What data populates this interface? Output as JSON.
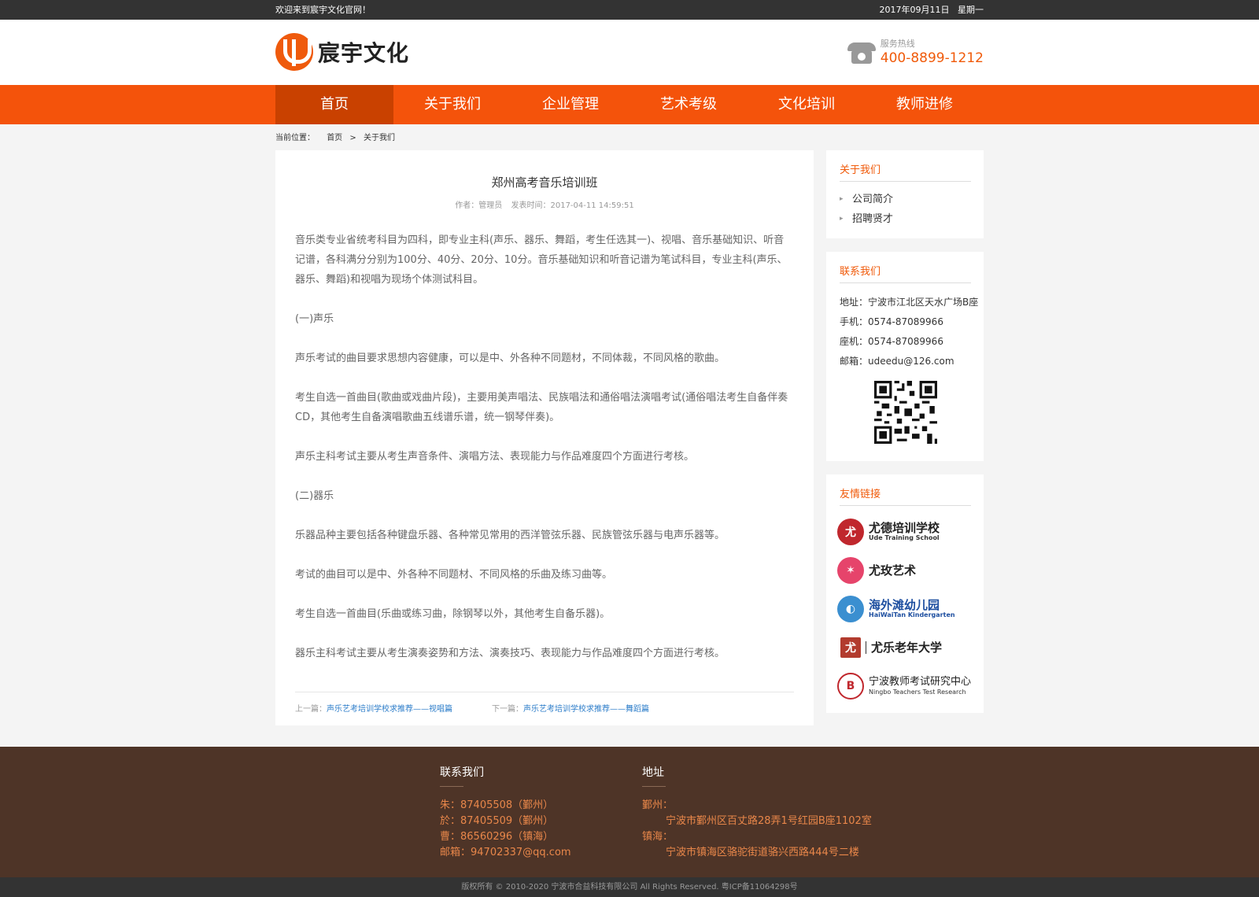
{
  "topbar": {
    "welcome": "欢迎来到宸宇文化官网！",
    "date": "2017年09月11日",
    "weekday": "星期一"
  },
  "header": {
    "logo_text": "宸宇文化",
    "hotline_label": "服务热线",
    "hotline_number": "400-8899-1212"
  },
  "nav": {
    "items": [
      "首页",
      "关于我们",
      "企业管理",
      "艺术考级",
      "文化培训",
      "教师进修"
    ],
    "active": "首页"
  },
  "breadcrumb": {
    "label": "当前位置：",
    "home": "首页",
    "sep": ">",
    "current": "关于我们"
  },
  "article": {
    "title": "郑州高考音乐培训班",
    "author": "作者：管理员",
    "time": "发表时间：2017-04-11 14:59:51",
    "paragraphs": [
      "音乐类专业省统考科目为四科，即专业主科(声乐、器乐、舞蹈，考生任选其一)、视唱、音乐基础知识、听音记谱，各科满分分别为100分、40分、20分、10分。音乐基础知识和听音记谱为笔试科目，专业主科(声乐、器乐、舞蹈)和视唱为现场个体测试科目。",
      "(一)声乐",
      "声乐考试的曲目要求思想内容健康，可以是中、外各种不同题材，不同体裁，不同风格的歌曲。",
      "考生自选一首曲目(歌曲或戏曲片段)，主要用美声唱法、民族唱法和通俗唱法演唱考试(通俗唱法考生自备伴奏CD，其他考生自备演唱歌曲五线谱乐谱，统一钢琴伴奏)。",
      "声乐主科考试主要从考生声音条件、演唱方法、表现能力与作品难度四个方面进行考核。",
      "(二)器乐",
      "乐器品种主要包括各种键盘乐器、各种常见常用的西洋管弦乐器、民族管弦乐器与电声乐器等。",
      "考试的曲目可以是中、外各种不同题材、不同风格的乐曲及练习曲等。",
      "考生自选一首曲目(乐曲或练习曲，除钢琴以外，其他考生自备乐器)。",
      "器乐主科考试主要从考生演奏姿势和方法、演奏技巧、表现能力与作品难度四个方面进行考核。"
    ],
    "prev_label": "上一篇：",
    "prev_link": "声乐艺考培训学校求推荐——视唱篇",
    "next_label": "下一篇：",
    "next_link": "声乐艺考培训学校求推荐——舞蹈篇"
  },
  "sidebar": {
    "about": {
      "title": "关于我们",
      "items": [
        "公司简介",
        "招聘贤才"
      ]
    },
    "contact": {
      "title": "联系我们",
      "address": "地址：宁波市江北区天水广场B座",
      "mobile": "手机：0574-87089966",
      "phone": "座机：0574-87089966",
      "email": "邮箱：udeedu@126.com"
    },
    "links": {
      "title": "友情链接",
      "items": [
        {
          "name": "尤德培训学校",
          "sub": "Ude Training School",
          "mark": "尤",
          "color": "#c0272d"
        },
        {
          "name": "尤玫艺术",
          "sub": "",
          "mark": "✶",
          "color": "#e6446b"
        },
        {
          "name": "海外滩幼儿园",
          "sub": "HaiWaiTan Kindergarten",
          "mark": "◐",
          "color": "#3b8fd0"
        },
        {
          "name": "尤乐老年大学",
          "sub": "",
          "mark": "尤",
          "color": "#b23b2e"
        },
        {
          "name": "宁波教师考试研究中心",
          "sub": "Ningbo Teachers Test Research",
          "mark": "B",
          "color": "#c0272d"
        }
      ]
    }
  },
  "footer": {
    "contact_title": "联系我们",
    "contacts": [
      "朱：87405508（鄞州）",
      "於：87405509（鄞州）",
      "曹：86560296（镇海）",
      "邮箱：94702337@qq.com"
    ],
    "address_title": "地址",
    "yinzhou_label": "鄞州：",
    "yinzhou_addr": "宁波市鄞州区百丈路28弄1号红园B座1102室",
    "zhenhai_label": "镇海：",
    "zhenhai_addr": "宁波市镇海区骆驼街道骆兴西路444号二楼",
    "copyright": "版权所有 © 2010-2020 宁波市合益科技有限公司 All Rights Reserved. 粤ICP备11064298号"
  },
  "colors": {
    "brand": "#f4530b",
    "nav_active": "#c94100",
    "footer": "#4e3427",
    "link": "#2b7cc9"
  }
}
